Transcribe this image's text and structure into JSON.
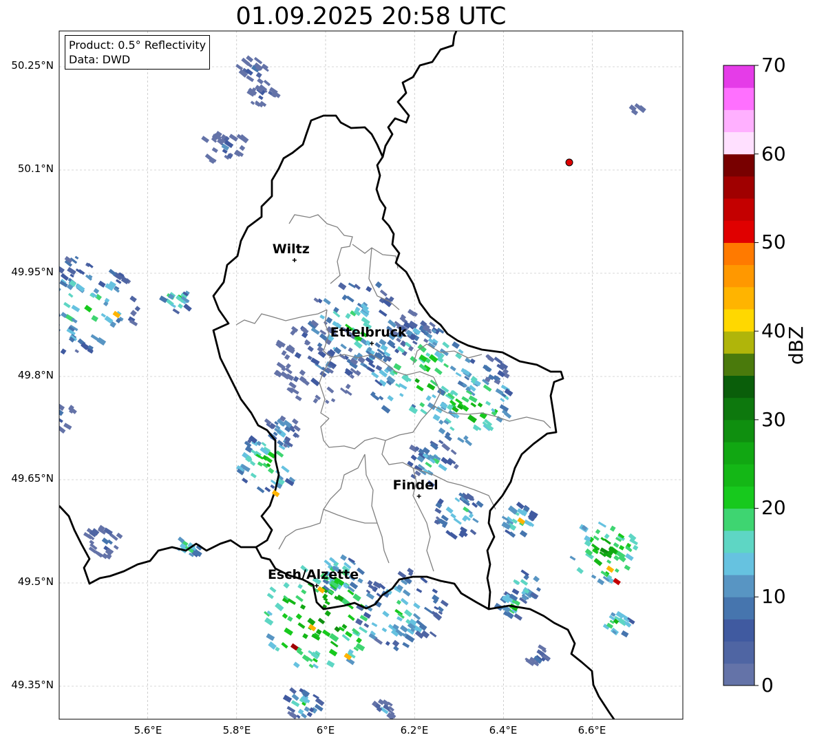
{
  "title": "01.09.2025 20:58 UTC",
  "info": {
    "product": "Product: 0.5° Reflectivity",
    "source": "Data: DWD"
  },
  "lat_labels": [
    "50.25°N",
    "50.1°N",
    "49.95°N",
    "49.8°N",
    "49.65°N",
    "49.5°N",
    "49.35°N"
  ],
  "lon_labels": [
    "5.6°E",
    "5.8°E",
    "6°E",
    "6.2°E",
    "6.4°E",
    "6.6°E"
  ],
  "colorbar": {
    "label": "dBZ",
    "ticks": [
      "0",
      "10",
      "20",
      "30",
      "40",
      "50",
      "60",
      "70"
    ],
    "colors": [
      "#6473a8",
      "#4f65a3",
      "#405aa0",
      "#4675ae",
      "#5895c3",
      "#66c2e0",
      "#5ed6c4",
      "#3ed571",
      "#17c91d",
      "#14b716",
      "#11a712",
      "#0f8f0f",
      "#0d780d",
      "#0a5e0a",
      "#4a7a0c",
      "#b0b50a",
      "#ffd800",
      "#ffb400",
      "#ff9800",
      "#ff7a00",
      "#e00000",
      "#c40000",
      "#a00000",
      "#780000",
      "#ffe0ff",
      "#ffb0ff",
      "#ff70ff",
      "#e53ce8"
    ]
  },
  "cities": [
    {
      "name": "Wiltz",
      "lon": 5.93,
      "lat": 49.969
    },
    {
      "name": "Ettelbruck",
      "lon": 6.104,
      "lat": 49.848
    },
    {
      "name": "Findel",
      "lon": 6.21,
      "lat": 49.626
    },
    {
      "name": "Esch/Alzette",
      "lon": 5.98,
      "lat": 49.496
    }
  ],
  "marker": {
    "lon": 6.548,
    "lat": 50.111,
    "color": "#dd0000"
  },
  "echo_cells": [
    {
      "lon": 5.455,
      "lat": 49.902,
      "dbz": 18,
      "spread": 30
    },
    {
      "lon": 5.663,
      "lat": 49.911,
      "dbz": 20,
      "spread": 6
    },
    {
      "lon": 5.39,
      "lat": 49.745,
      "dbz": 8,
      "spread": 10
    },
    {
      "lon": 5.837,
      "lat": 50.245,
      "dbz": 8,
      "spread": 6
    },
    {
      "lon": 5.86,
      "lat": 50.21,
      "dbz": 8,
      "spread": 6
    },
    {
      "lon": 5.773,
      "lat": 50.135,
      "dbz": 8,
      "spread": 10
    },
    {
      "lon": 6.07,
      "lat": 49.868,
      "dbz": 18,
      "spread": 30
    },
    {
      "lon": 5.985,
      "lat": 49.82,
      "dbz": 8,
      "spread": 24
    },
    {
      "lon": 6.22,
      "lat": 49.8,
      "dbz": 22,
      "spread": 30
    },
    {
      "lon": 6.33,
      "lat": 49.755,
      "dbz": 24,
      "spread": 22
    },
    {
      "lon": 6.38,
      "lat": 49.81,
      "dbz": 14,
      "spread": 6
    },
    {
      "lon": 6.2,
      "lat": 49.865,
      "dbz": 10,
      "spread": 10
    },
    {
      "lon": 5.87,
      "lat": 49.675,
      "dbz": 22,
      "spread": 16
    },
    {
      "lon": 5.9,
      "lat": 49.72,
      "dbz": 14,
      "spread": 8
    },
    {
      "lon": 6.24,
      "lat": 49.675,
      "dbz": 16,
      "spread": 12
    },
    {
      "lon": 6.3,
      "lat": 49.6,
      "dbz": 18,
      "spread": 12
    },
    {
      "lon": 6.435,
      "lat": 49.59,
      "dbz": 20,
      "spread": 8
    },
    {
      "lon": 5.5,
      "lat": 49.56,
      "dbz": 10,
      "spread": 8
    },
    {
      "lon": 5.69,
      "lat": 49.553,
      "dbz": 20,
      "spread": 5
    },
    {
      "lon": 6.035,
      "lat": 49.51,
      "dbz": 22,
      "spread": 10
    },
    {
      "lon": 5.99,
      "lat": 49.45,
      "dbz": 28,
      "spread": 32
    },
    {
      "lon": 6.17,
      "lat": 49.46,
      "dbz": 18,
      "spread": 24
    },
    {
      "lon": 6.45,
      "lat": 49.497,
      "dbz": 20,
      "spread": 6
    },
    {
      "lon": 6.42,
      "lat": 49.467,
      "dbz": 20,
      "spread": 6
    },
    {
      "lon": 6.63,
      "lat": 49.545,
      "dbz": 26,
      "spread": 18
    },
    {
      "lon": 6.655,
      "lat": 49.44,
      "dbz": 22,
      "spread": 6
    },
    {
      "lon": 6.48,
      "lat": 49.39,
      "dbz": 8,
      "spread": 5
    },
    {
      "lon": 5.95,
      "lat": 49.325,
      "dbz": 18,
      "spread": 8
    },
    {
      "lon": 6.13,
      "lat": 49.315,
      "dbz": 8,
      "spread": 4
    },
    {
      "lon": 6.7,
      "lat": 50.187,
      "dbz": 8,
      "spread": 1
    }
  ],
  "hotspots": [
    {
      "lon": 5.93,
      "lat": 49.407,
      "dbz": 56
    },
    {
      "lon": 6.05,
      "lat": 49.393,
      "dbz": 44
    },
    {
      "lon": 5.97,
      "lat": 49.435,
      "dbz": 44
    },
    {
      "lon": 6.655,
      "lat": 49.502,
      "dbz": 54
    },
    {
      "lon": 6.64,
      "lat": 49.52,
      "dbz": 44
    },
    {
      "lon": 5.888,
      "lat": 49.63,
      "dbz": 44
    },
    {
      "lon": 5.53,
      "lat": 49.89,
      "dbz": 44
    },
    {
      "lon": 6.44,
      "lat": 49.59,
      "dbz": 44
    },
    {
      "lon": 5.99,
      "lat": 49.49,
      "dbz": 44
    }
  ]
}
